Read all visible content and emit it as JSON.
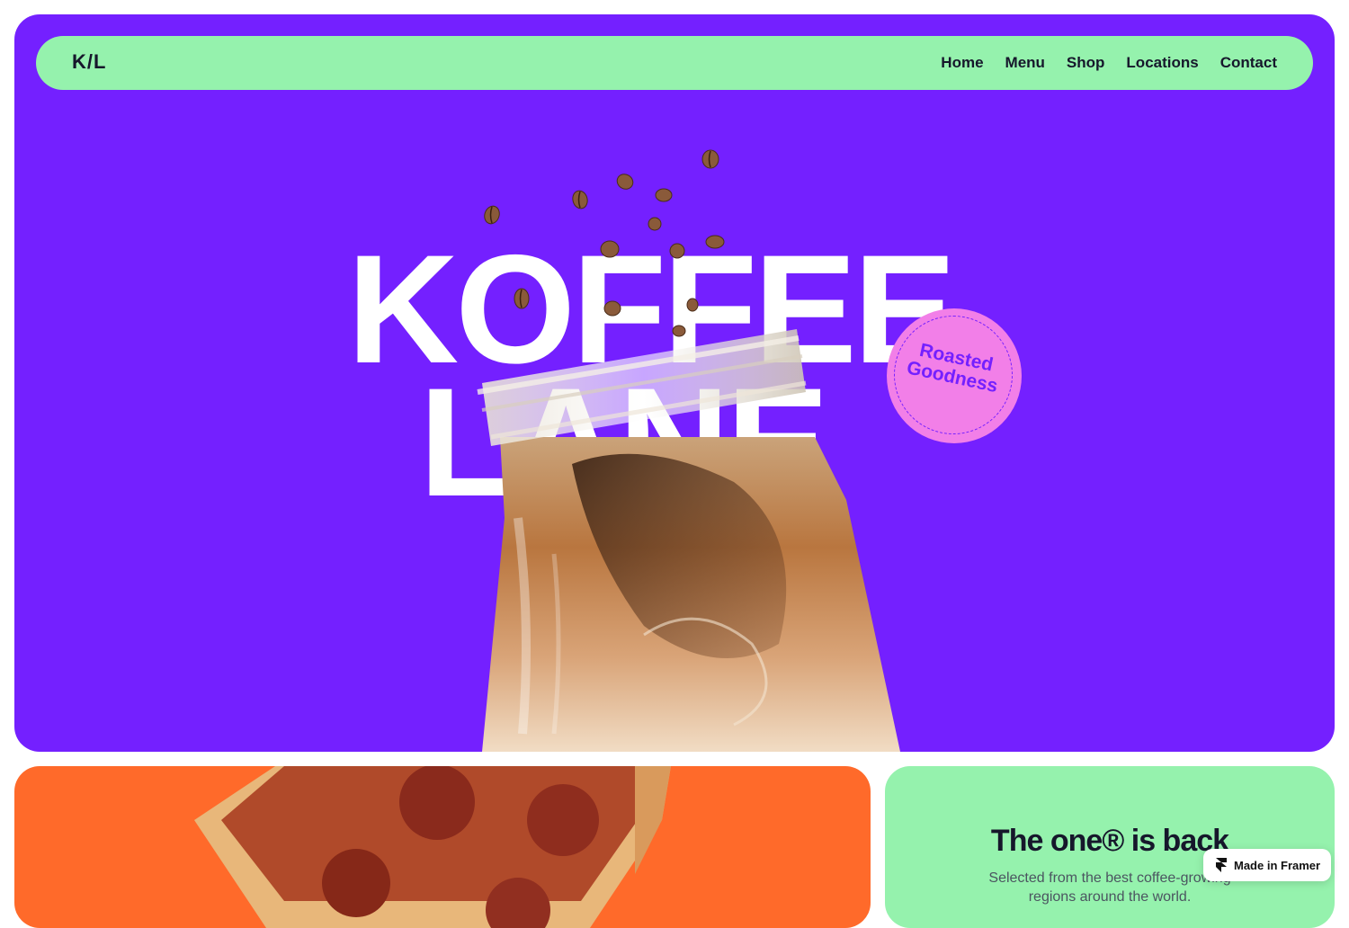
{
  "nav": {
    "logo": "K/L",
    "links": [
      "Home",
      "Menu",
      "Shop",
      "Locations",
      "Contact"
    ]
  },
  "hero": {
    "title_line1": "KOFFEE",
    "title_line2": "LANE",
    "badge_text": "Roasted Goodness",
    "background_color": "#7420ff"
  },
  "promo": {
    "title": "The one® is back",
    "text": "Selected from the best coffee-growing regions around the world."
  },
  "framer_badge": {
    "label": "Made in Framer",
    "icon": "framer-icon"
  },
  "colors": {
    "accent_green": "#95f2ad",
    "accent_pink": "#f27fe8",
    "accent_orange": "#ff6a2a",
    "dark_text": "#16172b"
  }
}
